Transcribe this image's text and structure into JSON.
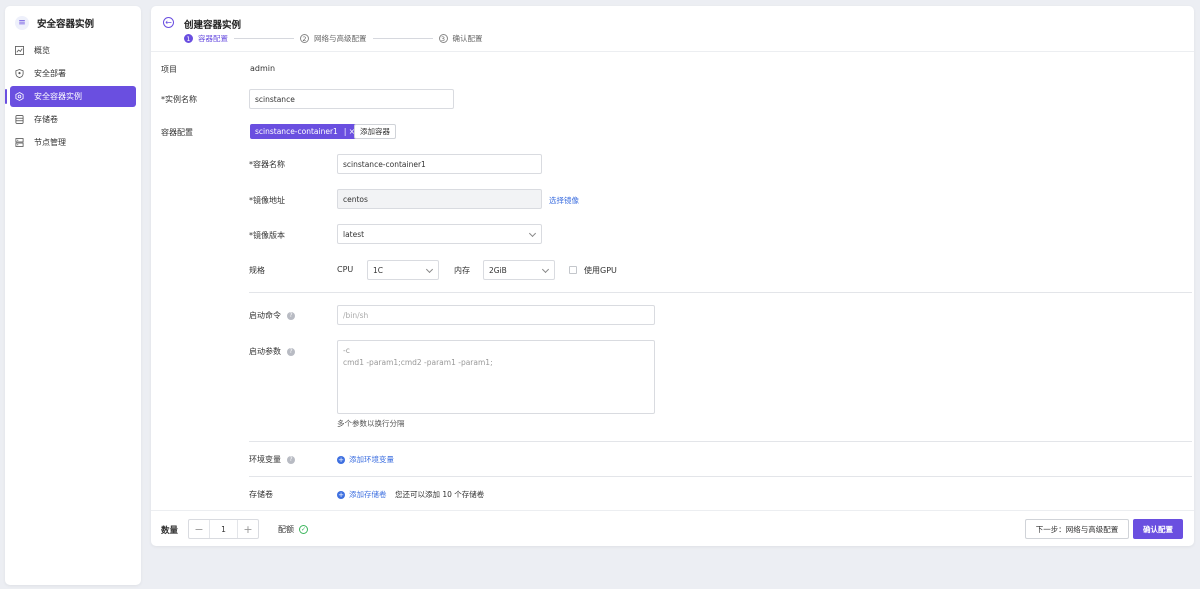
{
  "sidebar": {
    "title": "安全容器实例",
    "items": [
      {
        "label": "概览"
      },
      {
        "label": "安全部署"
      },
      {
        "label": "安全容器实例"
      },
      {
        "label": "存储卷"
      },
      {
        "label": "节点管理"
      }
    ]
  },
  "header": {
    "title": "创建容器实例",
    "steps": [
      {
        "num": "1",
        "label": "容器配置"
      },
      {
        "num": "2",
        "label": "网络与高级配置"
      },
      {
        "num": "3",
        "label": "确认配置"
      }
    ]
  },
  "form": {
    "project_label": "项目",
    "project_value": "admin",
    "name_label": "*实例名称",
    "name_value": "scinstance",
    "container_config_label": "容器配置",
    "container_tag": "scinstance-container1",
    "tag_close": "| ×",
    "add_container": "添加容器",
    "container_name_label": "*容器名称",
    "container_name_value": "scinstance-container1",
    "image_label": "*镜像地址",
    "image_value": "centos",
    "select_image": "选择镜像",
    "image_version_label": "*镜像版本",
    "image_version_value": "latest",
    "spec_label": "规格",
    "cpu_label": "CPU",
    "cpu_value": "1C",
    "memory_label": "内存",
    "memory_value": "2GiB",
    "use_gpu": "使用GPU",
    "startup_cmd_label": "启动命令",
    "startup_cmd_placeholder": "/bin/sh",
    "startup_args_label": "启动参数",
    "startup_args_placeholder_1": "-c",
    "startup_args_placeholder_2": "cmd1 -param1;cmd2 -param1 -param1;",
    "args_hint": "多个参数以换行分隔",
    "env_label": "环境变量",
    "add_env": "添加环境变量",
    "volume_label": "存储卷",
    "add_volume": "添加存储卷",
    "volume_hint": "您还可以添加 10 个存储卷"
  },
  "footer": {
    "quantity_label": "数量",
    "quantity_minus": "−",
    "quantity_value": "1",
    "quantity_plus": "+",
    "quota_label": "配额",
    "quota_icon_glyph": "✓",
    "next_button": "下一步：网络与高级配置",
    "confirm_button": "确认配置"
  },
  "colors": {
    "accent": "#6a4fe0",
    "link": "#3d6fe0",
    "success": "#3bb55c"
  }
}
